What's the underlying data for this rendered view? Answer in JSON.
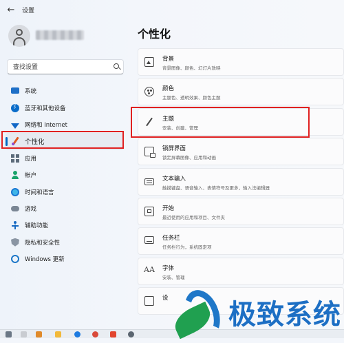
{
  "window": {
    "title": "设置"
  },
  "search": {
    "placeholder": "查找设置"
  },
  "sidebar": {
    "items": [
      {
        "label": "系统"
      },
      {
        "label": "蓝牙和其他设备"
      },
      {
        "label": "网络和 Internet"
      },
      {
        "label": "个性化",
        "active": true
      },
      {
        "label": "应用"
      },
      {
        "label": "帐户"
      },
      {
        "label": "时间和语言"
      },
      {
        "label": "游戏"
      },
      {
        "label": "辅助功能"
      },
      {
        "label": "隐私和安全性"
      },
      {
        "label": "Windows 更新"
      }
    ]
  },
  "main": {
    "title": "个性化",
    "cards": [
      {
        "title": "背景",
        "subtitle": "背景图像、颜色、幻灯片放映",
        "icon": "image-icon"
      },
      {
        "title": "颜色",
        "subtitle": "主题色、透明效果、颜色主题",
        "icon": "palette-icon"
      },
      {
        "title": "主题",
        "subtitle": "安装、创建、管理",
        "icon": "brush-icon"
      },
      {
        "title": "锁屏界面",
        "subtitle": "锁定屏幕图像、应用和动画",
        "icon": "lock-screen-icon"
      },
      {
        "title": "文本输入",
        "subtitle": "触摸键盘、语音输入、表情符号及更多，输入法编辑器",
        "icon": "keyboard-icon"
      },
      {
        "title": "开始",
        "subtitle": "最近使用的应用和项目、文件夹",
        "icon": "start-icon"
      },
      {
        "title": "任务栏",
        "subtitle": "任务栏行为，系统固定项",
        "icon": "taskbar-icon"
      },
      {
        "title": "字体",
        "subtitle": "安装、管理",
        "icon": "font-icon"
      },
      {
        "title": "设",
        "subtitle": "",
        "icon": "device-usage-icon"
      }
    ]
  },
  "watermark": {
    "text": "极致系统"
  },
  "colors": {
    "accent": "#0067c0",
    "highlight": "#e02020",
    "watermark": "#1d6fc4"
  }
}
